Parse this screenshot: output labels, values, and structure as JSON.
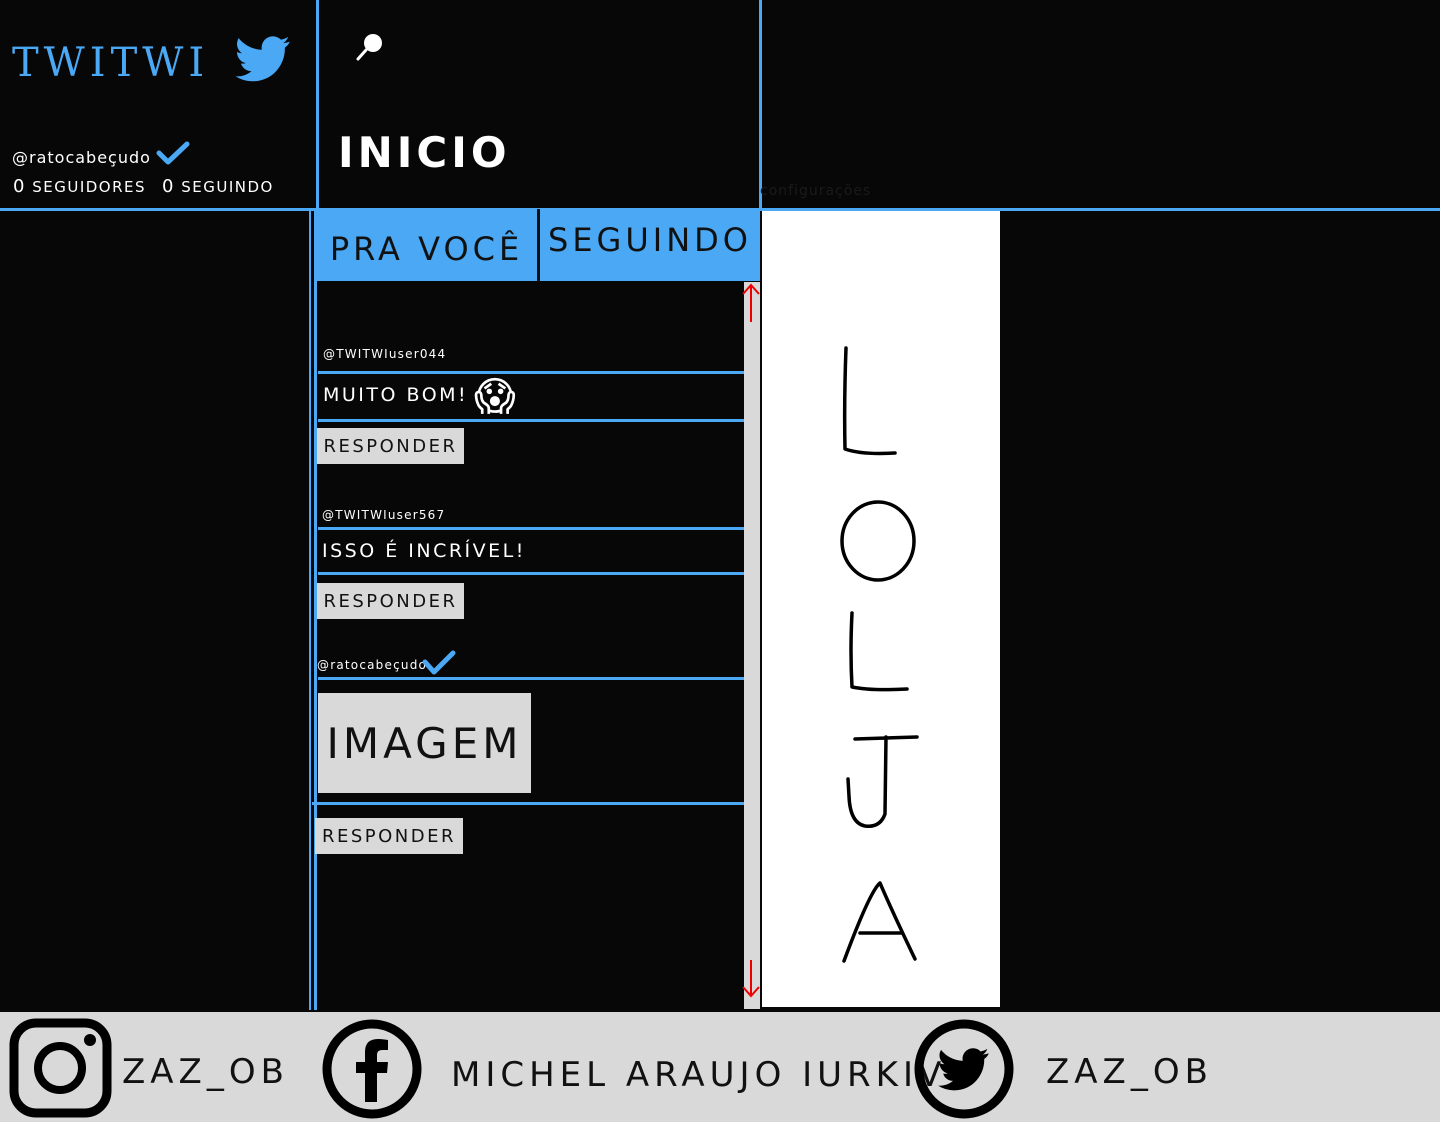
{
  "brand": {
    "name": "TWITWI",
    "accent_color": "#4aa8f5",
    "logo_icon": "twitter-bird-icon"
  },
  "profile": {
    "handle": "@ratocabeçudo",
    "followers_count": "0",
    "followers_label": "SEGUIDORES",
    "following_count": "0",
    "following_label": "SEGUINDO"
  },
  "header": {
    "search_icon": "search-icon",
    "title": "INICIO",
    "settings_label": "configurações"
  },
  "tabs": [
    {
      "label": "PRA VOCÊ"
    },
    {
      "label": "SEGUINDO"
    }
  ],
  "feed": {
    "posts": [
      {
        "handle": "@TWITWIuser044",
        "text": "MUITO BOM!",
        "emoji": "😱",
        "reply_label": "RESPONDER"
      },
      {
        "handle": "@TWITWIuser567",
        "text": "ISSO É INCRÍVEL!",
        "reply_label": "RESPONDER"
      },
      {
        "handle": "@ratocabeçudo",
        "image_label": "IMAGEM",
        "reply_label": "RESPONDER"
      }
    ]
  },
  "ad": {
    "letters": [
      "L",
      "O",
      "L",
      "J",
      "A"
    ]
  },
  "footer": {
    "items": [
      {
        "icon": "instagram-icon",
        "label": "ZAZ_OB"
      },
      {
        "icon": "facebook-icon",
        "label": "MICHEL ARAUJO IURKIV"
      },
      {
        "icon": "twitter-icon",
        "label": "ZAZ_OB"
      }
    ]
  }
}
